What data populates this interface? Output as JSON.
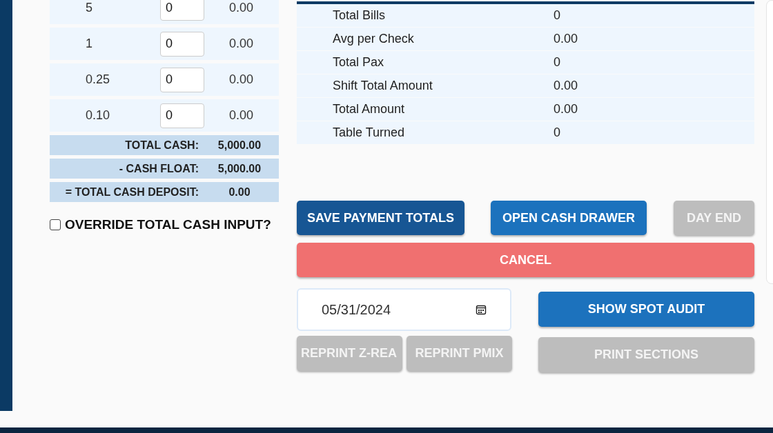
{
  "denominations": [
    {
      "denomination": "5",
      "count": "0",
      "amount": "0.00"
    },
    {
      "denomination": "1",
      "count": "0",
      "amount": "0.00"
    },
    {
      "denomination": "0.25",
      "count": "0",
      "amount": "0.00"
    },
    {
      "denomination": "0.10",
      "count": "0",
      "amount": "0.00"
    }
  ],
  "totals": [
    {
      "label": "TOTAL CASH:",
      "value": "5,000.00"
    },
    {
      "label": "- CASH FLOAT:",
      "value": "5,000.00"
    },
    {
      "label": "= TOTAL CASH DEPOSIT:",
      "value": "0.00"
    }
  ],
  "override": {
    "label": "OVERRIDE TOTAL CASH INPUT?",
    "checked": false
  },
  "stats": [
    {
      "label": "Total Bills",
      "value": "0"
    },
    {
      "label": "Avg per Check",
      "value": "0.00"
    },
    {
      "label": "Total Pax",
      "value": "0"
    },
    {
      "label": "Shift Total Amount",
      "value": "0.00"
    },
    {
      "label": "Total Amount",
      "value": "0.00"
    },
    {
      "label": "Table Turned",
      "value": "0"
    }
  ],
  "action_buttons": [
    {
      "label": "SAVE PAYMENT TOTALS",
      "kind": "dark"
    },
    {
      "label": "OPEN CASH DRAWER",
      "kind": "primary"
    },
    {
      "label": "DAY END",
      "kind": "disabled"
    }
  ],
  "cancel_button": {
    "label": "CANCEL",
    "kind": "danger"
  },
  "date_field": {
    "value": "05/31/2024"
  },
  "show_spot_audit_button": {
    "label": "SHOW SPOT AUDIT",
    "kind": "primary"
  },
  "reprint_buttons": [
    {
      "label": "REPRINT Z-REA",
      "kind": "disabled"
    },
    {
      "label": "REPRINT PMIX",
      "kind": "disabled"
    }
  ],
  "print_sections_button": {
    "label": "PRINT SECTIONS",
    "kind": "disabled"
  }
}
